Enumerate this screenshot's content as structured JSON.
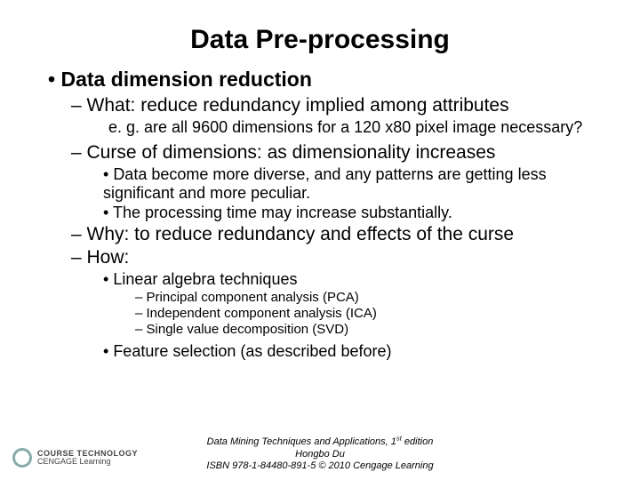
{
  "title": "Data Pre-processing",
  "l1": "Data dimension reduction",
  "l2_what": "What: reduce redundancy implied among attributes",
  "eg": "e. g. are all 9600 dimensions for a 120 x80 pixel image necessary?",
  "l2_curse": "Curse of dimensions: as dimensionality increases",
  "curse_b1": "Data become more diverse, and any patterns are getting less significant and more peculiar.",
  "curse_b2": "The processing time may increase substantially.",
  "l2_why": "Why: to reduce redundancy and effects of the curse",
  "l2_how": "How:",
  "how_b1": "Linear algebra techniques",
  "tech1": "Principal component analysis (PCA)",
  "tech2": "Independent component analysis (ICA)",
  "tech3": "Single value decomposition (SVD)",
  "how_b2": "Feature selection (as described before)",
  "footer1_a": "Data Mining Techniques and Applications, 1",
  "footer1_b": " edition",
  "footer1_sup": "st",
  "footer2": "Hongbo Du",
  "footer3": "ISBN 978-1-84480-891-5 © 2010 Cengage Learning",
  "logo_line1": "COURSE TECHNOLOGY",
  "logo_line2": "CENGAGE Learning"
}
